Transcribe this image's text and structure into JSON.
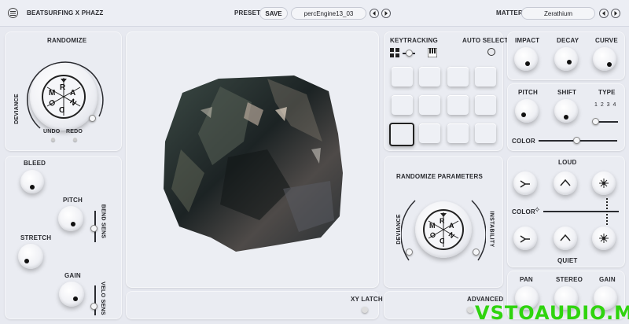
{
  "header": {
    "menu_icon": "menu-icon",
    "app_title": "BEATSURFING X PHAZZ",
    "preset_label": "PRESET",
    "save_label": "SAVE",
    "preset_name": "percEngine13_03",
    "matter_label": "MATTER",
    "matter_name": "Zerathium"
  },
  "randomize_panel": {
    "title": "RANDOMIZE",
    "deviance": "DEVIANCE",
    "letters": [
      "R",
      "A",
      "N",
      "D",
      "O",
      "M"
    ],
    "undo": "UNDO",
    "redo": "REDO"
  },
  "left_controls": {
    "bleed": "BLEED",
    "pitch": "PITCH",
    "bend_sens": "BEND SENS",
    "stretch": "STRETCH",
    "gain": "GAIN",
    "velo_sens": "VELO SENS"
  },
  "center": {
    "xy_latch": "XY LATCH"
  },
  "keytracking": {
    "title": "KEYTRACKING",
    "auto_select": "AUTO SELECT",
    "selected_pad": 8
  },
  "randomize_parameters": {
    "title": "RANDOMIZE PARAMETERS",
    "deviance": "DEVIANCE",
    "instability": "INSTABILITY",
    "letters": [
      "R",
      "A",
      "N",
      "D",
      "O",
      "M"
    ],
    "advanced": "ADVANCED"
  },
  "right_top": {
    "impact": "IMPACT",
    "decay": "DECAY",
    "curve": "CURVE"
  },
  "right_mid": {
    "pitch": "PITCH",
    "shift": "SHIFT",
    "type": "TYPE",
    "type_options": "1 2 3 4",
    "color": "COLOR"
  },
  "loud_quiet": {
    "loud": "LOUD",
    "color": "COLOR",
    "quiet": "QUIET"
  },
  "right_bottom": {
    "pan": "PAN",
    "stereo": "STEREO",
    "gain": "GAIN"
  },
  "watermark": "VSTOAUDIO.ME",
  "colors": {
    "background": "#e7e9f0",
    "panel": "#eaecf2",
    "text": "#1e1f24",
    "watermark_green": "#2fd40e"
  }
}
